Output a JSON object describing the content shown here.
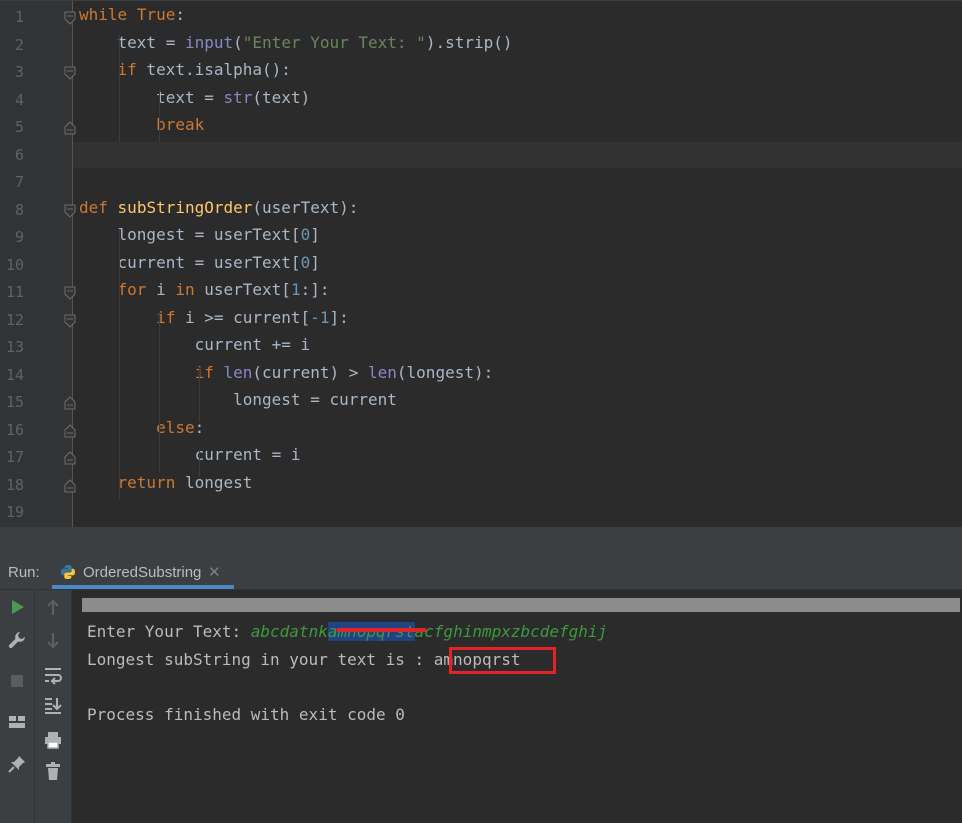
{
  "editor": {
    "lines": [
      {
        "n": "1",
        "html": "<span class=\"kw\">while</span> <span class=\"kw\">True</span>:"
      },
      {
        "n": "2",
        "html": "    text = <span class=\"bi\">input</span>(<span class=\"str\">\"Enter Your Text: \"</span>).strip()"
      },
      {
        "n": "3",
        "html": "    <span class=\"kw\">if</span> text.isalpha():"
      },
      {
        "n": "4",
        "html": "        text = <span class=\"bi\">str</span>(text)"
      },
      {
        "n": "5",
        "html": "        <span class=\"kw\">break</span>"
      },
      {
        "n": "6",
        "html": ""
      },
      {
        "n": "7",
        "html": ""
      },
      {
        "n": "8",
        "html": "<span class=\"kw\">def</span> <span class=\"fn\">subStringOrder</span>(userText):"
      },
      {
        "n": "9",
        "html": "    longest = userText[<span class=\"num\">0</span>]"
      },
      {
        "n": "10",
        "html": "    current = userText[<span class=\"num\">0</span>]"
      },
      {
        "n": "11",
        "html": "    <span class=\"kw\">for</span> i <span class=\"kw\">in</span> userText[<span class=\"num\">1</span>:]:"
      },
      {
        "n": "12",
        "html": "        <span class=\"kw\">if</span> i >= current[<span class=\"num\">-1</span>]:"
      },
      {
        "n": "13",
        "html": "            current += i"
      },
      {
        "n": "14",
        "html": "            <span class=\"kw\">if</span> <span class=\"bi\">len</span>(current) > <span class=\"bi\">len</span>(longest):"
      },
      {
        "n": "15",
        "html": "                longest = current"
      },
      {
        "n": "16",
        "html": "        <span class=\"kw\">else</span>:"
      },
      {
        "n": "17",
        "html": "            current = i"
      },
      {
        "n": "18",
        "html": "    <span class=\"kw\">return</span> longest"
      },
      {
        "n": "19",
        "html": ""
      }
    ]
  },
  "run_panel": {
    "label": "Run:",
    "tab_name": "OrderedSubstring",
    "close_glyph": "✕"
  },
  "console": {
    "prompt": "Enter Your Text: ",
    "input_before": "abcdatnk",
    "input_selected": "amnopqrst",
    "input_after": "acfghinmpxzbcdefghij",
    "result_label": "Longest subString in your text is : ",
    "result_value": "amnopqrst",
    "exit_message": "Process finished with exit code 0"
  },
  "colors": {
    "accent": "#4a88c7",
    "highlight_red": "#e22428",
    "run_green": "#499c54"
  }
}
